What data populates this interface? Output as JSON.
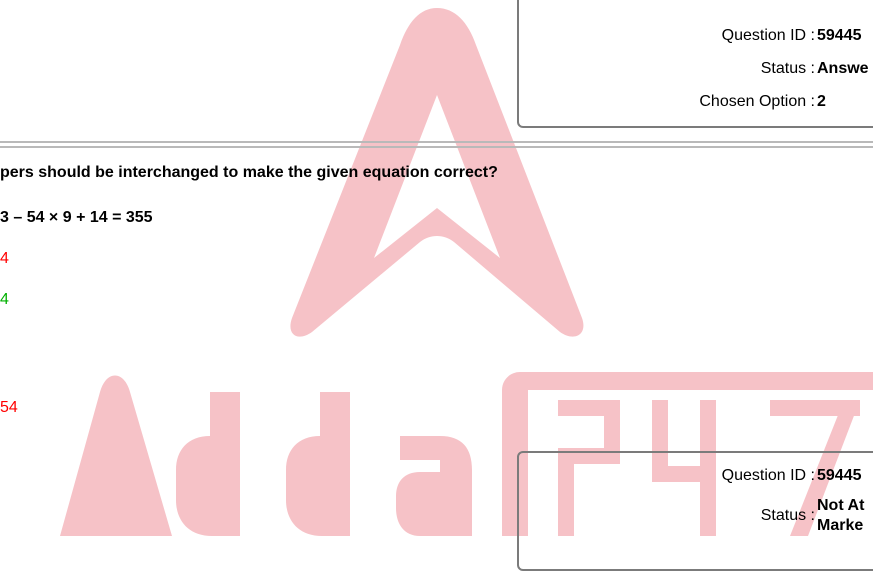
{
  "status_top": {
    "question_id_label": "Question ID :",
    "question_id_value": "59445",
    "status_label": "Status :",
    "status_value": "Answe",
    "chosen_option_label": "Chosen Option :",
    "chosen_option_value": "2"
  },
  "question": {
    "text": "pers should be interchanged to make the given equation correct?",
    "equation": "3 – 54 × 9 + 14 = 355",
    "options": [
      {
        "text": "4",
        "color": "#ff0000"
      },
      {
        "text": "4",
        "color": "#00b000"
      },
      {
        "text": "54",
        "color": "#ff0000"
      }
    ]
  },
  "status_bottom": {
    "question_id_label": "Question ID :",
    "question_id_value": "59445",
    "status_label": "Status :",
    "status_value_line1": "Not At",
    "status_value_line2": "Marke"
  },
  "watermark": {
    "text_left": "Adda",
    "text_right": "247",
    "color": "#f4b6bc"
  }
}
